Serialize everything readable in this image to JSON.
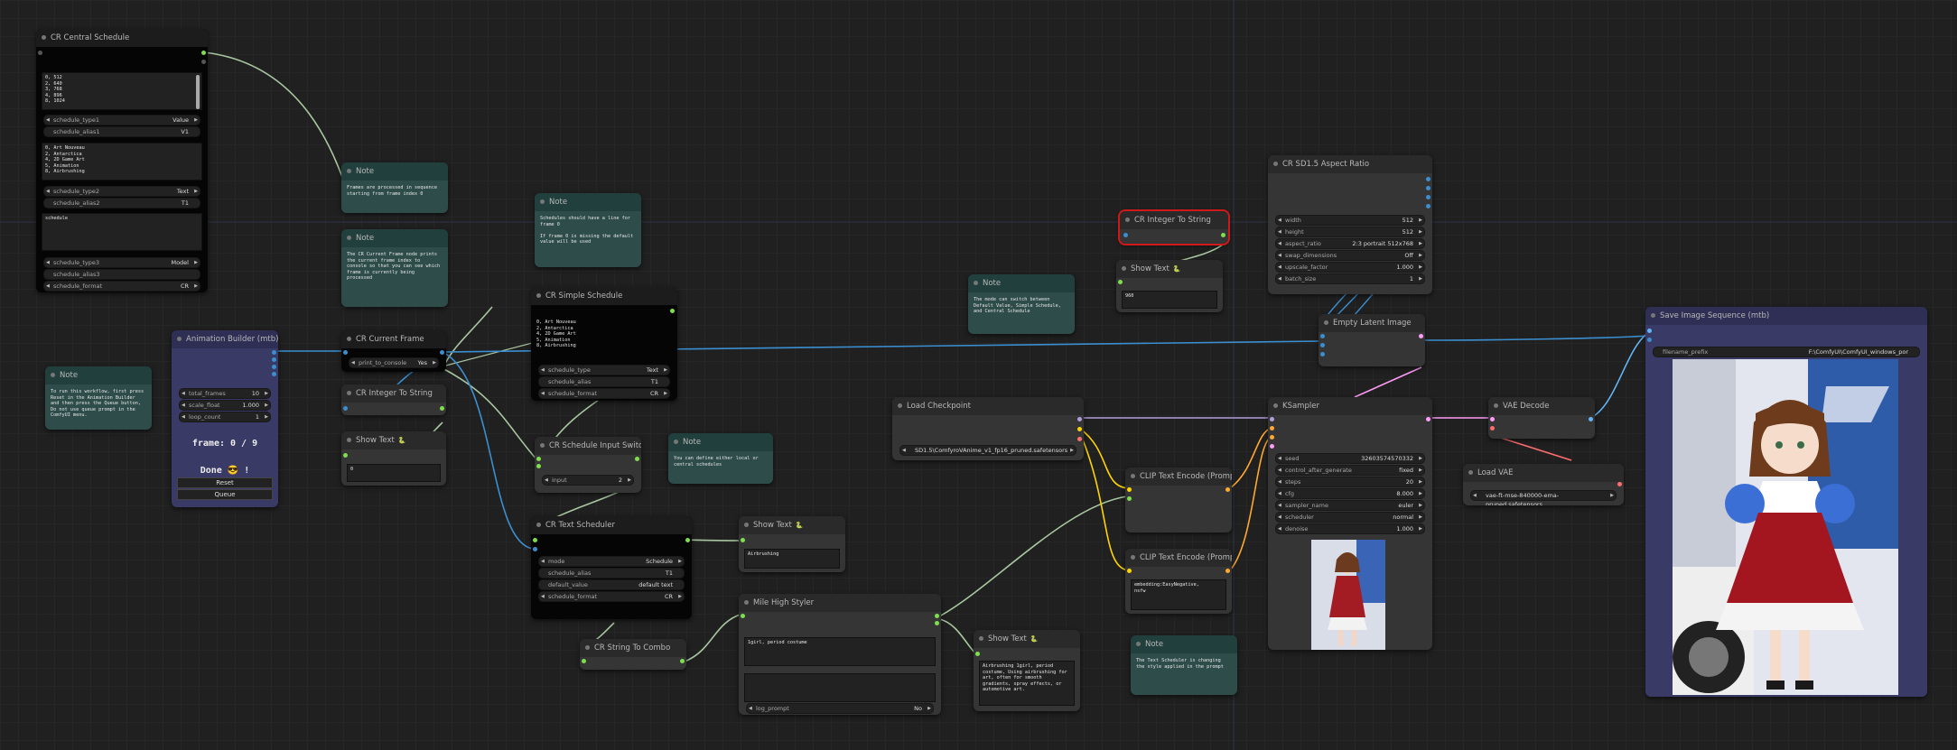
{
  "nodes": {
    "cr_central_schedule": {
      "title": "CR Central Schedule",
      "schedule1_text": "0, 512\n2, 640\n3, 768\n4, 896\n8, 1024",
      "schedule_type1": {
        "label": "schedule_type1",
        "value": "Value"
      },
      "schedule_alias1": {
        "label": "schedule_alias1",
        "value": "V1"
      },
      "schedule2_text": "0, Art Nouveau\n2, Antarctica\n4, 2D Game Art\n5, Animation\n8, Airbrushing",
      "schedule_type2": {
        "label": "schedule_type2",
        "value": "Text"
      },
      "schedule_alias2": {
        "label": "schedule_alias2",
        "value": "T1"
      },
      "schedule3_text": "schedule",
      "schedule_type3": {
        "label": "schedule_type3",
        "value": "Model"
      },
      "schedule_alias3": {
        "label": "schedule_alias3",
        "value": ""
      },
      "schedule_format": {
        "label": "schedule_format",
        "value": "CR"
      }
    },
    "note_frames": {
      "title": "Note",
      "text": "Frames are processed in sequence starting from frame index 0"
    },
    "note_current_frame": {
      "title": "Note",
      "text": "The CR Current Frame node prints the current frame index to console so that you can see which frame is currently being processed"
    },
    "note_schedules": {
      "title": "Note",
      "text": "Schedules should have a line for frame 0\n\nIf frame 0 is missing the default value will be used"
    },
    "cr_simple_schedule": {
      "title": "CR Simple Schedule",
      "text": "0, Art Nouveau\n2, Antarctica\n4, 2D Game Art\n5, Animation\n8, Airbrushing",
      "schedule_type": {
        "label": "schedule_type",
        "value": "Text"
      },
      "schedule_alias": {
        "label": "schedule_alias",
        "value": "T1"
      },
      "schedule_format": {
        "label": "schedule_format",
        "value": "CR"
      }
    },
    "note_workflow": {
      "title": "Note",
      "text": "To run this workflow, first press Reset in the Animation Builder and then press the Queue button, Do not use queue prompt in the ComfyUI menu."
    },
    "animation_builder": {
      "title": "Animation Builder (mtb)",
      "total_frames": {
        "label": "total_frames",
        "value": "10"
      },
      "scale_float": {
        "label": "scale_float",
        "value": "1.000"
      },
      "loop_count": {
        "label": "loop_count",
        "value": "1"
      },
      "frame_text": "frame: 0 / 9",
      "done_text": "Done 😎 !",
      "reset_label": "Reset",
      "queue_label": "Queue"
    },
    "cr_current_frame": {
      "title": "CR Current Frame",
      "print_to_console": {
        "label": "print_to_console",
        "value": "Yes"
      }
    },
    "cr_integer_to_string_1": {
      "title": "CR Integer To String"
    },
    "show_text_1": {
      "title": "Show Text",
      "lock": "🐍",
      "text": "0"
    },
    "cr_schedule_input_switch": {
      "title": "CR Schedule Input Switch",
      "input": {
        "label": "input",
        "value": "2"
      }
    },
    "note_define": {
      "title": "Note",
      "text": "You can define either local or central schedules"
    },
    "cr_text_scheduler": {
      "title": "CR Text Scheduler",
      "mode": {
        "label": "mode",
        "value": "Schedule"
      },
      "schedule_alias": {
        "label": "schedule_alias",
        "value": "T1"
      },
      "default_value": {
        "label": "default_value",
        "value": "default text"
      },
      "schedule_format": {
        "label": "schedule_format",
        "value": "CR"
      }
    },
    "show_text_2": {
      "title": "Show Text",
      "lock": "🐍",
      "text": "Airbrushing"
    },
    "cr_string_to_combo": {
      "title": "CR String To Combo"
    },
    "mile_high_styler": {
      "title": "Mile High Styler",
      "text": "1girl, period costume",
      "log_prompt": {
        "label": "log_prompt",
        "value": "No"
      }
    },
    "show_text_3": {
      "title": "Show Text",
      "lock": "🐍",
      "text": "Airbrushing 1girl, period costume, Using airbrushing for art, often for smooth gradients, spray effects, or automotive art."
    },
    "note_mode": {
      "title": "Note",
      "text": "The mode can switch between Default Value, Simple Schedule, and Central Schedule"
    },
    "load_checkpoint": {
      "title": "Load Checkpoint",
      "ckpt": "SD1.5\\ComfyroVAnime_v1_fp16_pruned.safetensors"
    },
    "cr_integer_to_string_2": {
      "title": "CR Integer To String"
    },
    "show_text_4": {
      "title": "Show Text",
      "lock": "🐍",
      "text": "960"
    },
    "clip_text_encode_1": {
      "title": "CLIP Text Encode (Prompt)"
    },
    "clip_text_encode_2": {
      "title": "CLIP Text Encode (Prompt)",
      "text": "embedding:EasyNegative,\nnsfw"
    },
    "note_text_scheduler": {
      "title": "Note",
      "text": "The Text Scheduler is changing the style applied in the prompt"
    },
    "cr_sd15_aspect_ratio": {
      "title": "CR SD1.5 Aspect Ratio",
      "width": {
        "label": "width",
        "value": "512"
      },
      "height": {
        "label": "height",
        "value": "512"
      },
      "aspect_ratio": {
        "label": "aspect_ratio",
        "value": "2:3 portrait 512x768"
      },
      "swap_dimensions": {
        "label": "swap_dimensions",
        "value": "Off"
      },
      "upscale_factor": {
        "label": "upscale_factor",
        "value": "1.000"
      },
      "batch_size": {
        "label": "batch_size",
        "value": "1"
      }
    },
    "empty_latent_image": {
      "title": "Empty Latent Image"
    },
    "ksampler": {
      "title": "KSampler",
      "seed": {
        "label": "seed",
        "value": "32603574570332"
      },
      "control_after_generate": {
        "label": "control_after_generate",
        "value": "fixed"
      },
      "steps": {
        "label": "steps",
        "value": "20"
      },
      "cfg": {
        "label": "cfg",
        "value": "8.000"
      },
      "sampler_name": {
        "label": "sampler_name",
        "value": "euler"
      },
      "scheduler": {
        "label": "scheduler",
        "value": "normal"
      },
      "denoise": {
        "label": "denoise",
        "value": "1.000"
      }
    },
    "vae_decode": {
      "title": "VAE Decode"
    },
    "load_vae": {
      "title": "Load VAE",
      "vae_name": "vae-ft-mse-840000-ema-pruned.safetensors"
    },
    "save_image_sequence": {
      "title": "Save Image Sequence (mtb)",
      "filename_prefix": {
        "label": "filename_prefix",
        "value": "F:\\ComfyUI\\ComfyUI_windows_por"
      }
    }
  },
  "colors": {
    "wire_model": "#b39ddb",
    "wire_clip": "#ffd500",
    "wire_conditioning": "#ffa931",
    "wire_latent": "#ff9cf9",
    "wire_image": "#64b5f6",
    "wire_vae": "#ff6e6e",
    "wire_string": "#a8c7a0",
    "wire_int": "#3b8fd1",
    "slot_green": "#7ede4e"
  }
}
